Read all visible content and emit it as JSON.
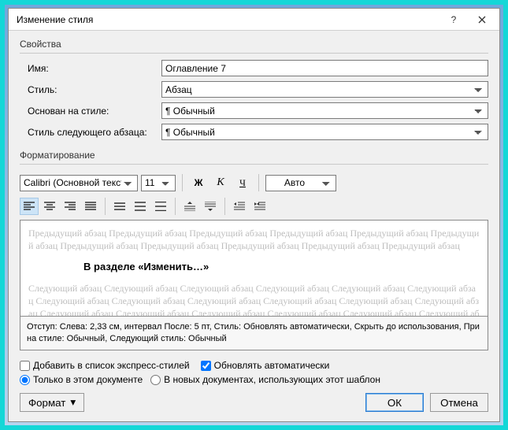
{
  "title": "Изменение стиля",
  "group_props": "Свойства",
  "fields": {
    "name_label": "Имя:",
    "name_value": "Оглавление 7",
    "style_label": "Стиль:",
    "style_value": "Абзац",
    "based_label": "Основан на стиле:",
    "based_value": "¶ Обычный",
    "next_label": "Стиль следующего абзаца:",
    "next_value": "¶ Обычный"
  },
  "group_fmt": "Форматирование",
  "font": {
    "name": "Calibri (Основной текст)",
    "size": "11",
    "bold": "Ж",
    "italic": "К",
    "underline": "Ч",
    "color": "Авто"
  },
  "preview": {
    "before": "Предыдущий абзац Предыдущий абзац Предыдущий абзац Предыдущий абзац Предыдущий абзац Предыдущий абзац Предыдущий абзац Предыдущий абзац Предыдущий абзац Предыдущий абзац Предыдущий абзац",
    "sample": "В разделе «Изменить…»",
    "after": "Следующий абзац Следующий абзац Следующий абзац Следующий абзац Следующий абзац Следующий абзац Следующий абзац Следующий абзац Следующий абзац Следующий абзац Следующий абзац Следующий абзац Следующий абзац Следующий абзац Следующий абзац Следующий абзац Следующий абзац Следующий абзац"
  },
  "description": "Отступ: Слева:  2,33 см, интервал После:  5 пт, Стиль: Обновлять автоматически, Скрыть до использования, При на стиле: Обычный, Следующий стиль: Обычный",
  "checks": {
    "quick": "Добавить в список экспресс-стилей",
    "auto": "Обновлять автоматически",
    "this_doc": "Только в этом документе",
    "new_docs": "В новых документах, использующих этот шаблон"
  },
  "buttons": {
    "format": "Формат",
    "ok": "ОК",
    "cancel": "Отмена"
  }
}
